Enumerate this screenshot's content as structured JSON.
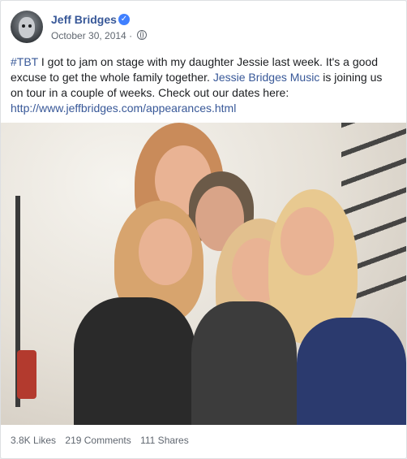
{
  "post": {
    "author": "Jeff Bridges",
    "date": "October 30, 2014",
    "separator": "·",
    "text": {
      "hashtag": "#TBT",
      "part1": " I got to jam on stage with my daughter Jessie last week. It's a good excuse to get the whole family together. ",
      "mention": "Jessie Bridges Music",
      "part2": " is joining us on tour in a couple of weeks. Check out our dates here:",
      "url": "http://www.jeffbridges.com/appearances.html"
    },
    "verified_icon": "check-circle-icon",
    "privacy_icon": "globe-icon",
    "accent_color": "#385898"
  },
  "stats": {
    "likes": "3.8K Likes",
    "comments": "219 Comments",
    "shares": "111 Shares"
  }
}
